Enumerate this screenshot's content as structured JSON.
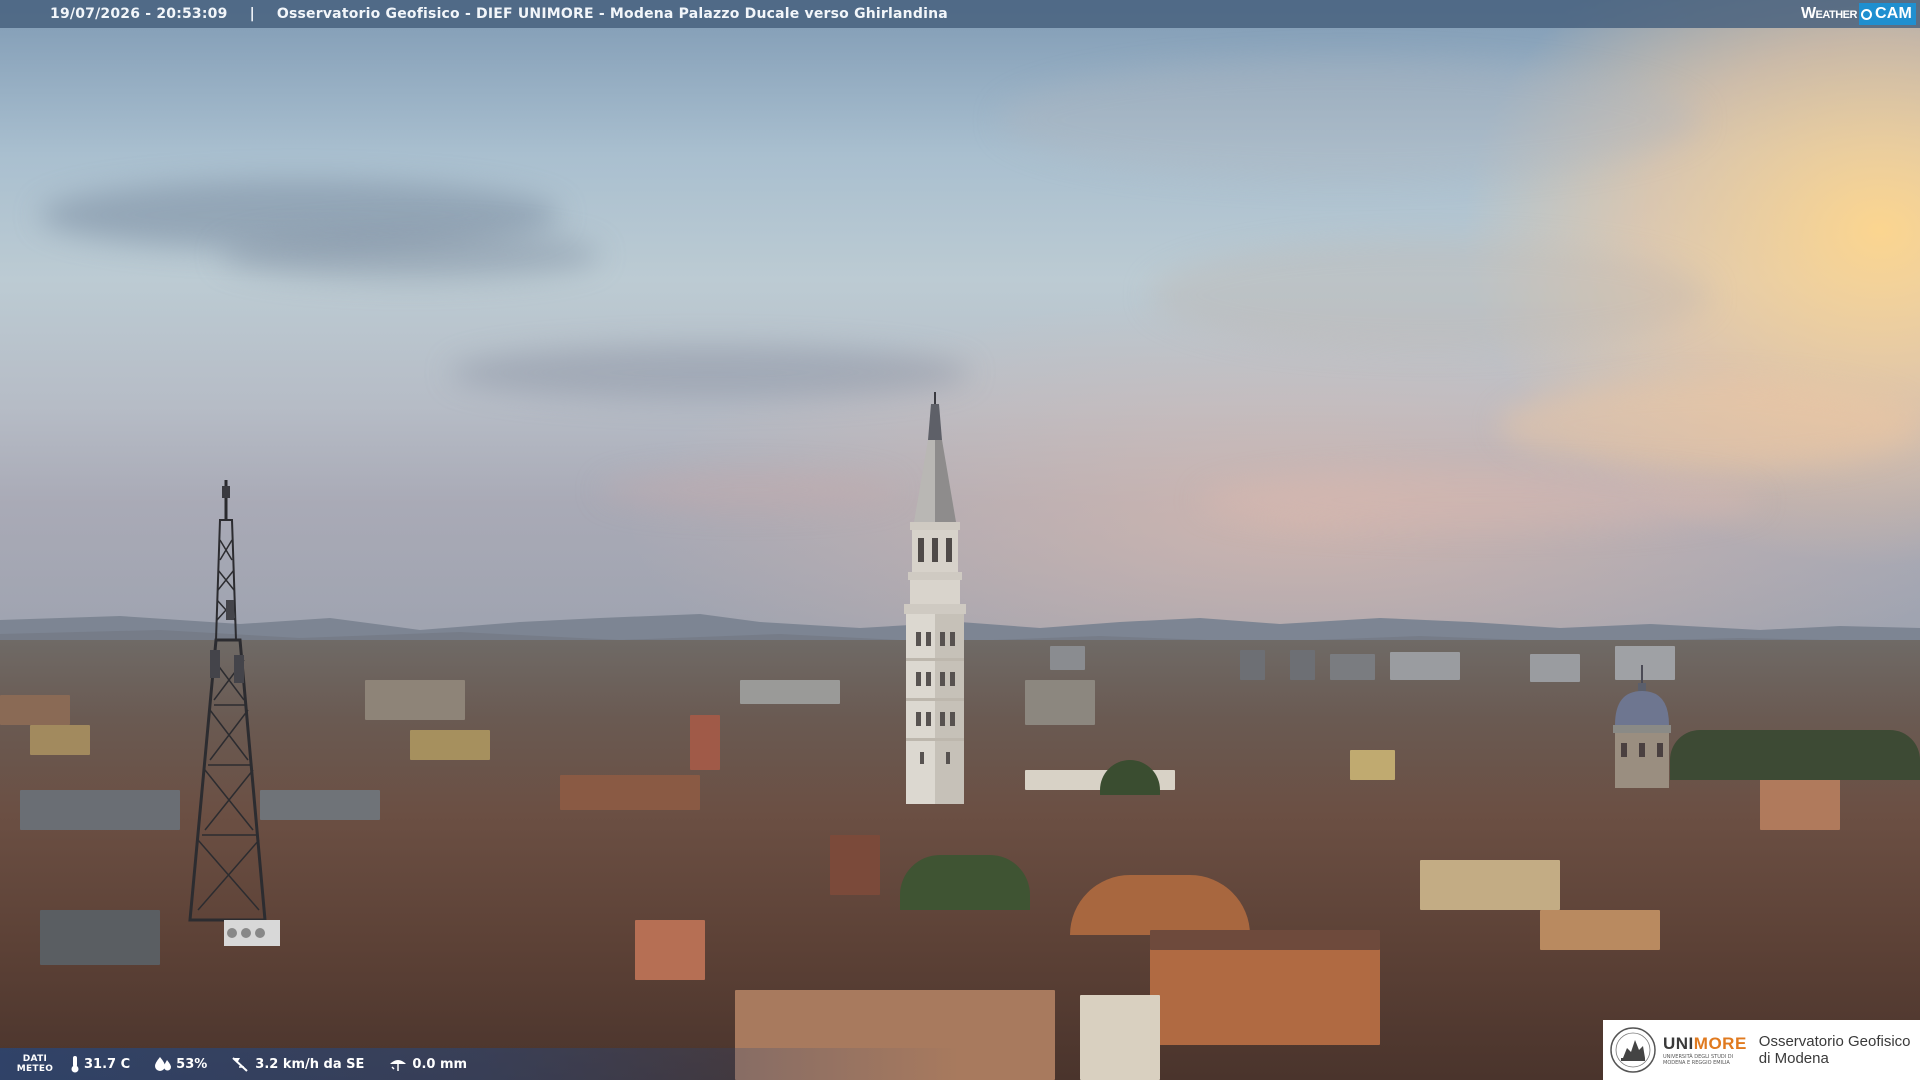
{
  "top_bar": {
    "timestamp": "19/07/2026 - 20:53:09",
    "separator": "|",
    "title": "Osservatorio Geofisico - DIEF UNIMORE - Modena Palazzo Ducale verso Ghirlandina"
  },
  "brand": {
    "weather": "Weather",
    "cam": "CAM"
  },
  "meteo_bar": {
    "label_line1": "DATI",
    "label_line2": "METEO",
    "temperature": "31.7 C",
    "humidity": "53%",
    "wind": "3.2 km/h da SE",
    "rain": "0.0 mm",
    "icons": [
      "thermometer-icon",
      "humidity-drop-icon",
      "wind-vane-icon",
      "rain-gauge-icon"
    ]
  },
  "logo": {
    "uni_part1": "UNI",
    "uni_part2": "MORE",
    "uni_subtitle": "UNIVERSITÀ DEGLI STUDI DI\nMODENA E REGGIO EMILIA",
    "observatory_line1": "Osservatorio Geofisico",
    "observatory_line2": "di Modena",
    "accent_color": "#e07a1f"
  }
}
